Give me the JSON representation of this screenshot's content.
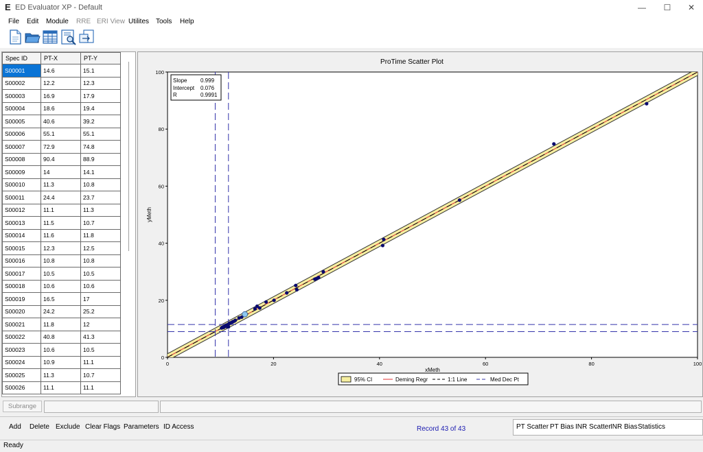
{
  "window": {
    "title": "ED Evaluator XP - Default",
    "app_icon": "E",
    "minimize": "—",
    "maximize": "☐",
    "close": "✕"
  },
  "menu": [
    {
      "label": "File",
      "enabled": true
    },
    {
      "label": "Edit",
      "enabled": true
    },
    {
      "label": "Module",
      "enabled": true
    },
    {
      "label": "RRE",
      "enabled": false
    },
    {
      "label": "ERI View",
      "enabled": false
    },
    {
      "label": "Utilites",
      "enabled": true
    },
    {
      "label": "Tools",
      "enabled": true
    },
    {
      "label": "Help",
      "enabled": true
    }
  ],
  "toolbar": {
    "icons": [
      "new-document-icon",
      "open-folder-icon",
      "data-grid-icon",
      "report-search-icon",
      "export-icon"
    ]
  },
  "grid": {
    "headers": [
      "Spec ID",
      "PT-X",
      "PT-Y"
    ],
    "selected_row": 0,
    "rows": [
      [
        "S00001",
        "14.6",
        "15.1"
      ],
      [
        "S00002",
        "12.2",
        "12.3"
      ],
      [
        "S00003",
        "16.9",
        "17.9"
      ],
      [
        "S00004",
        "18.6",
        "19.4"
      ],
      [
        "S00005",
        "40.6",
        "39.2"
      ],
      [
        "S00006",
        "55.1",
        "55.1"
      ],
      [
        "S00007",
        "72.9",
        "74.8"
      ],
      [
        "S00008",
        "90.4",
        "88.9"
      ],
      [
        "S00009",
        "14",
        "14.1"
      ],
      [
        "S00010",
        "11.3",
        "10.8"
      ],
      [
        "S00011",
        "24.4",
        "23.7"
      ],
      [
        "S00012",
        "11.1",
        "11.3"
      ],
      [
        "S00013",
        "11.5",
        "10.7"
      ],
      [
        "S00014",
        "11.6",
        "11.8"
      ],
      [
        "S00015",
        "12.3",
        "12.5"
      ],
      [
        "S00016",
        "10.8",
        "10.8"
      ],
      [
        "S00017",
        "10.5",
        "10.5"
      ],
      [
        "S00018",
        "10.6",
        "10.6"
      ],
      [
        "S00019",
        "16.5",
        "17"
      ],
      [
        "S00020",
        "24.2",
        "25.2"
      ],
      [
        "S00021",
        "11.8",
        "12"
      ],
      [
        "S00022",
        "40.8",
        "41.3"
      ],
      [
        "S00023",
        "10.6",
        "10.5"
      ],
      [
        "S00024",
        "10.9",
        "11.1"
      ],
      [
        "S00025",
        "11.3",
        "10.7"
      ],
      [
        "S00026",
        "11.1",
        "11.1"
      ]
    ]
  },
  "chart_data": {
    "type": "scatter",
    "title": "ProTime Scatter Plot",
    "xlabel": "xMeth",
    "ylabel": "yMeth",
    "xlim": [
      0,
      100
    ],
    "ylim": [
      0,
      100
    ],
    "xticks": [
      0,
      20,
      40,
      60,
      80,
      100
    ],
    "yticks": [
      0,
      20,
      40,
      60,
      80,
      100
    ],
    "grid": false,
    "stats": [
      {
        "label": "Slope",
        "value": "0.999"
      },
      {
        "label": "Intercept",
        "value": "0.076"
      },
      {
        "label": "R",
        "value": "0.9991"
      }
    ],
    "regression": {
      "slope": 0.999,
      "intercept": 0.076
    },
    "ci_halfwidth": 1.2,
    "med_dec_pts": {
      "x": [
        9,
        11.5
      ],
      "y": [
        9,
        11.5
      ]
    },
    "highlight_point": {
      "x": 14.6,
      "y": 15.1
    },
    "points": {
      "x": [
        14.6,
        12.2,
        16.9,
        18.6,
        40.6,
        55.1,
        72.9,
        90.4,
        14,
        11.3,
        24.4,
        11.1,
        11.5,
        11.6,
        12.3,
        10.8,
        10.5,
        10.6,
        16.5,
        24.2,
        11.8,
        40.8,
        10.6,
        10.9,
        11.3,
        11.1,
        20.1,
        22.5,
        27.8,
        28.5,
        29.4,
        28.1,
        13.5,
        12.8,
        11.9,
        10.2,
        10.4,
        17.4,
        12.6,
        11.4,
        10.3,
        10.7,
        11.0
      ],
      "y": [
        15.1,
        12.3,
        17.9,
        19.4,
        39.2,
        55.1,
        74.8,
        88.9,
        14.1,
        10.8,
        23.7,
        11.3,
        10.7,
        11.8,
        12.5,
        10.8,
        10.5,
        10.6,
        17,
        25.2,
        12,
        41.3,
        10.5,
        11.1,
        10.7,
        11.1,
        20.0,
        22.6,
        27.4,
        28.0,
        30.0,
        27.6,
        13.8,
        13.0,
        12.1,
        10.3,
        10.6,
        17.3,
        12.7,
        11.5,
        10.4,
        10.8,
        11.1
      ]
    },
    "legend": {
      "placement": "bottom-center",
      "entries": [
        {
          "label": "95% CI",
          "style": "fill",
          "color": "#f5eea0"
        },
        {
          "label": "Deming Regr",
          "style": "solid",
          "color": "#e03030"
        },
        {
          "label": "1:1 Line",
          "style": "dashed",
          "color": "#000000"
        },
        {
          "label": "Med Dec Pt",
          "style": "dashed",
          "color": "#3333aa"
        }
      ]
    },
    "colors": {
      "point": "#0a0a6e",
      "highlight": "#8ec8f0",
      "ci_fill": "#f5eea0",
      "ci_border": "#333333",
      "med_dec": "#3333aa"
    }
  },
  "subrange": {
    "label": "Subrange"
  },
  "actions": [
    "Add",
    "Delete",
    "Exclude",
    "Clear Flags",
    "Parameters",
    "ID Access"
  ],
  "record_counter": "Record 43 of 43",
  "view_tabs": [
    {
      "label": "PT Scatter",
      "active": true
    },
    {
      "label": "PT Bias",
      "active": false
    },
    {
      "label": "INR Scatter",
      "active": false
    },
    {
      "label": "INR Bias",
      "active": false
    },
    {
      "label": "Statistics",
      "active": false
    }
  ],
  "status": "Ready"
}
